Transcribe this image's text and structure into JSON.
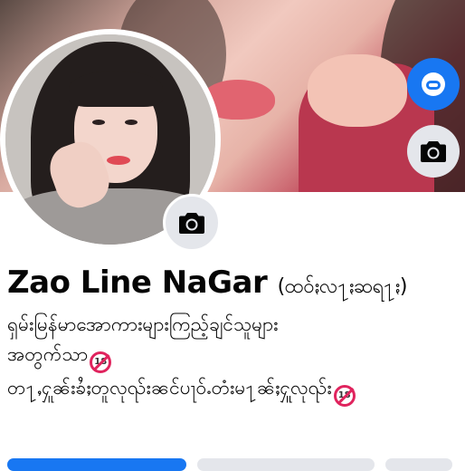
{
  "profile": {
    "name": "Zao Line NaGar",
    "alternate_name": "(ထဝ်ႏလ႑ႏဆရ႑ႏ)",
    "bio_lines": [
      "ရှမ်းမြန်မာအောကားများကြည့်ချင်သူများ",
      "အတွက်သာ",
      "တ႑ႇႁူၼ်းၶႆႈတူလုၺ်းၼင်ပႃဝ်ႉတံးမ႑ၼ်ႈႁူလုၺ်း"
    ],
    "badge_text": "18"
  },
  "icons": {
    "avatar_button": "avatar-icon",
    "cover_camera": "camera-icon",
    "profile_camera": "camera-icon"
  },
  "colors": {
    "accent": "#1877f2",
    "button_grey": "#e4e6eb",
    "no_18_red": "#e0245e"
  }
}
